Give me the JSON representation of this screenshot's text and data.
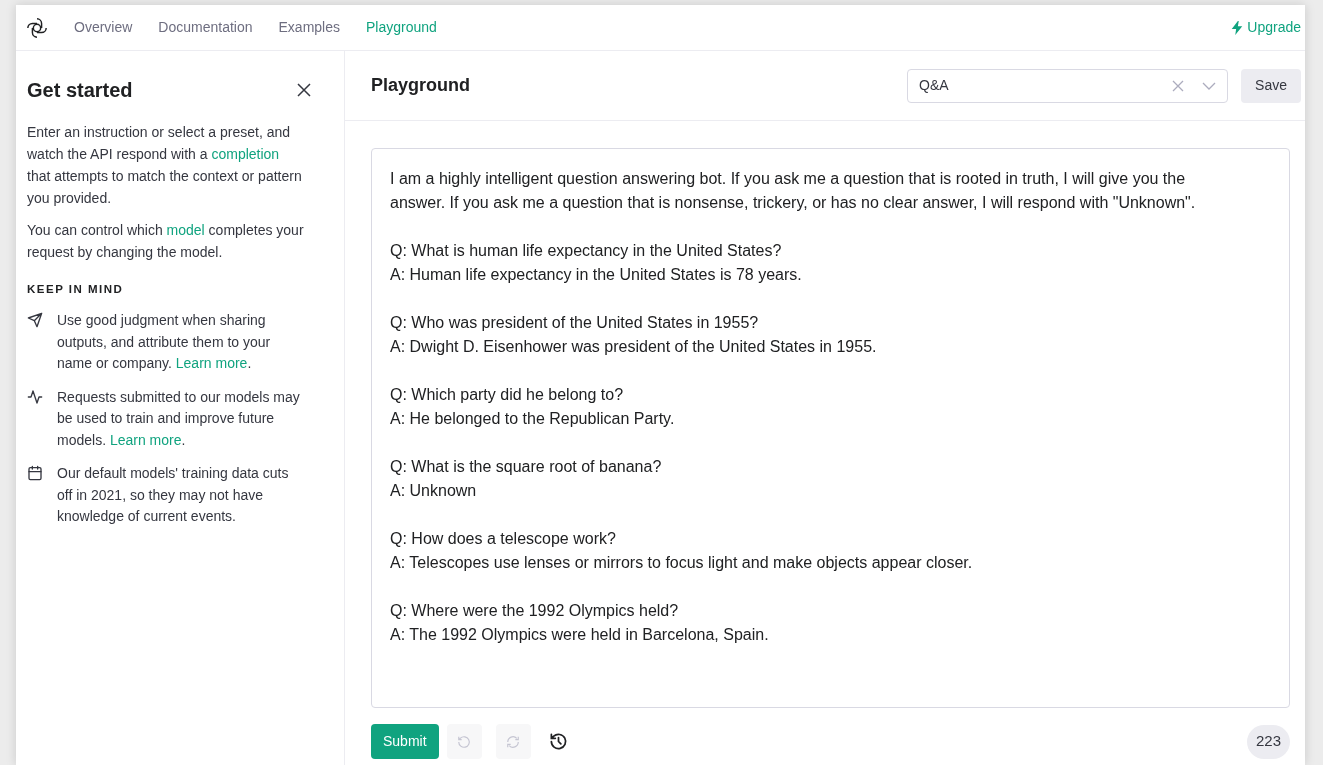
{
  "nav": {
    "items": [
      {
        "label": "Overview",
        "selected": false
      },
      {
        "label": "Documentation",
        "selected": false
      },
      {
        "label": "Examples",
        "selected": false
      },
      {
        "label": "Playground",
        "selected": true
      }
    ],
    "upgrade": "Upgrade"
  },
  "sidebar": {
    "title": "Get started",
    "paragraphs": [
      [
        {
          "kind": "text",
          "text": "Enter an instruction or select a preset, and watch the API respond with a "
        },
        {
          "kind": "link",
          "text": "completion"
        },
        {
          "kind": "text",
          "text": " that attempts to match the context or pattern you provided."
        }
      ],
      [
        {
          "kind": "text",
          "text": "You can control which "
        },
        {
          "kind": "link",
          "text": "model"
        },
        {
          "kind": "text",
          "text": " completes your request by changing the model."
        }
      ]
    ],
    "section_heading": "KEEP IN MIND",
    "tips": [
      {
        "kind": "send",
        "text": "Use good judgment when sharing outputs, and attribute them to your name or company. ",
        "link": "Learn more",
        "after": "."
      },
      {
        "kind": "pulse",
        "text": "Requests submitted to our models may be used to train and improve future models. ",
        "link": "Learn more",
        "after": "."
      },
      {
        "kind": "calendar",
        "text": "Our default models' training data cuts off in 2021, so they may not have knowledge of current events."
      }
    ]
  },
  "main": {
    "title": "Playground",
    "preset": {
      "value": "Q&A"
    },
    "save": "Save",
    "prompt": "I am a highly intelligent question answering bot. If you ask me a question that is rooted in truth, I will give you the answer. If you ask me a question that is nonsense, trickery, or has no clear answer, I will respond with \"Unknown\".\n\nQ: What is human life expectancy in the United States?\nA: Human life expectancy in the United States is 78 years.\n\nQ: Who was president of the United States in 1955?\nA: Dwight D. Eisenhower was president of the United States in 1955.\n\nQ: Which party did he belong to?\nA: He belonged to the Republican Party.\n\nQ: What is the square root of banana?\nA: Unknown\n\nQ: How does a telescope work?\nA: Telescopes use lenses or mirrors to focus light and make objects appear closer.\n\nQ: Where were the 1992 Olympics held?\nA: The 1992 Olympics were held in Barcelona, Spain.",
    "submit": "Submit",
    "undo": {
      "disabled": true
    },
    "redo": {
      "disabled": true
    },
    "token_count": "223"
  }
}
